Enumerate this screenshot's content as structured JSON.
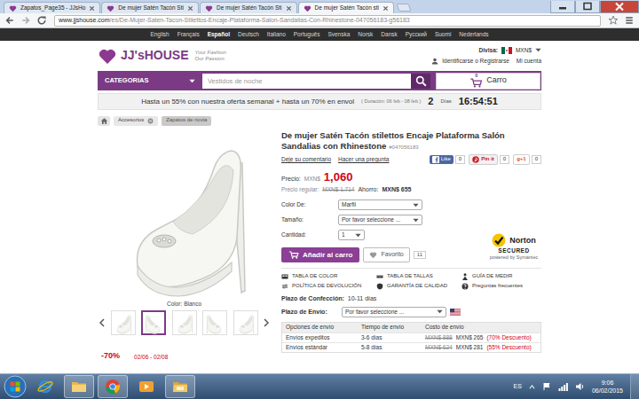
{
  "browser": {
    "tabs": [
      {
        "label": "Zapatos_Page35 - JJsHo",
        "selected": false
      },
      {
        "label": "De mujer Satén Tacón Sti",
        "selected": false
      },
      {
        "label": "De mujer Satén Tacón Sti",
        "selected": false
      },
      {
        "label": "De mujer Satén Tacón sti",
        "selected": true
      }
    ],
    "url_host": "www.jjshouse.com",
    "url_path": "/es/De-Mujer-Saten-Tacon-Stilettos-Encaje-Plataforma-Salon-Sandalias-Con-Rhinestone-047056183-g56183"
  },
  "languages": [
    {
      "label": "English",
      "selected": false
    },
    {
      "label": "Français",
      "selected": false
    },
    {
      "label": "Español",
      "selected": true
    },
    {
      "label": "Deutsch",
      "selected": false
    },
    {
      "label": "Italiano",
      "selected": false
    },
    {
      "label": "Português",
      "selected": false
    },
    {
      "label": "Svenska",
      "selected": false
    },
    {
      "label": "Norsk",
      "selected": false
    },
    {
      "label": "Dansk",
      "selected": false
    },
    {
      "label": "Русский",
      "selected": false
    },
    {
      "label": "Suomi",
      "selected": false
    },
    {
      "label": "Nederlands",
      "selected": false
    }
  ],
  "header": {
    "logo": "JJ'sHOUSE",
    "tagline_1": "Your Fashion",
    "tagline_2": "Our Passion.",
    "currency_label": "Divisa:",
    "currency": "MXN$",
    "login": "Identificarse o Registrarse",
    "account": "Mi cuenta"
  },
  "search": {
    "categories": "CATEGORIAS",
    "placeholder": "Vestidos de noche",
    "cart_count": "0",
    "cart_label": "Carro"
  },
  "promo": {
    "text": "Hasta un 55% con nuestra oferta semanal + hasta un 70% en envol",
    "duration": "( Duración: 06 feb - 08 feb )",
    "days": "2",
    "days_label": "Días",
    "timer": "16:54:51"
  },
  "breadcrumb": [
    {
      "label": "Accesorios",
      "selected": false
    },
    {
      "label": "Zapatos de novia",
      "selected": true
    }
  ],
  "gallery": {
    "caption": "Color: Blanco",
    "thumbnails": [
      {
        "selected": false
      },
      {
        "selected": true
      },
      {
        "selected": false
      },
      {
        "selected": false
      },
      {
        "selected": false
      }
    ],
    "deal": "-70%",
    "deal_dates": "02/06 - 02/08"
  },
  "product": {
    "title": "De mujer Satén Tacón stilettos Encaje Plataforma Salón Sandalias con Rhinestone",
    "sku": "#047056183",
    "review_link": "Deje su comentario",
    "question_link": "Hacer una pregunta",
    "social": [
      {
        "label": "Like",
        "count": "0"
      },
      {
        "label": "Pin it",
        "count": "0"
      },
      {
        "label": "g+1",
        "count": "0"
      }
    ],
    "price_label": "Precio:",
    "price_currency": "MXN$",
    "price": "1,060",
    "regular_label": "Precio regular:",
    "regular_price": "MXN$ 1,714",
    "saving_label": "Ahorro:",
    "saving": "MXN$ 655",
    "options": [
      {
        "label": "Color De:",
        "value": "Marfil"
      },
      {
        "label": "Tamaño:",
        "value": "Por favor seleccione ..."
      },
      {
        "label": "Cantidad:",
        "value": "1"
      }
    ],
    "add_to_cart": "Añadir al carro",
    "favorite": "Favorito",
    "favorite_count": "11",
    "norton": {
      "brand": "Norton",
      "status": "SECURED",
      "by": "powered by Symantec"
    },
    "info_links": [
      "TABLA DE COLOR",
      "TABLA DE TALLAS",
      "GUÍA DE MEDIR",
      "POLÍTICA DE DEVOLUCIÓN",
      "GARANTÍA DE CALIDAD",
      "Preguntas frecuentes"
    ],
    "production_label": "Plazo de Confección:",
    "production_time": "10-11 días",
    "shipping_label": "Plazo de Envío:",
    "shipping_select": "Por favor seleccione ...",
    "shipping_table": {
      "columns": [
        "Opciones de envío",
        "Tiempo de envío",
        "Costo de envío"
      ],
      "rows": [
        {
          "option": "Envíos expeditos",
          "time": "3-6 días",
          "old_cost": "MXN$ 888",
          "cost": "MXN$ 265",
          "discount": "(70% Descuento)"
        },
        {
          "option": "Envíos estándar",
          "time": "5-8 días",
          "old_cost": "MXN$ 624",
          "cost": "MXN$ 281",
          "discount": "(55% Descuento)"
        }
      ]
    }
  },
  "taskbar": {
    "language": "ES",
    "time": "9:06",
    "date": "06/02/2015",
    "apps": [
      {
        "active": false
      },
      {
        "active": true
      },
      {
        "active": true
      },
      {
        "active": false
      },
      {
        "active": true
      }
    ]
  }
}
